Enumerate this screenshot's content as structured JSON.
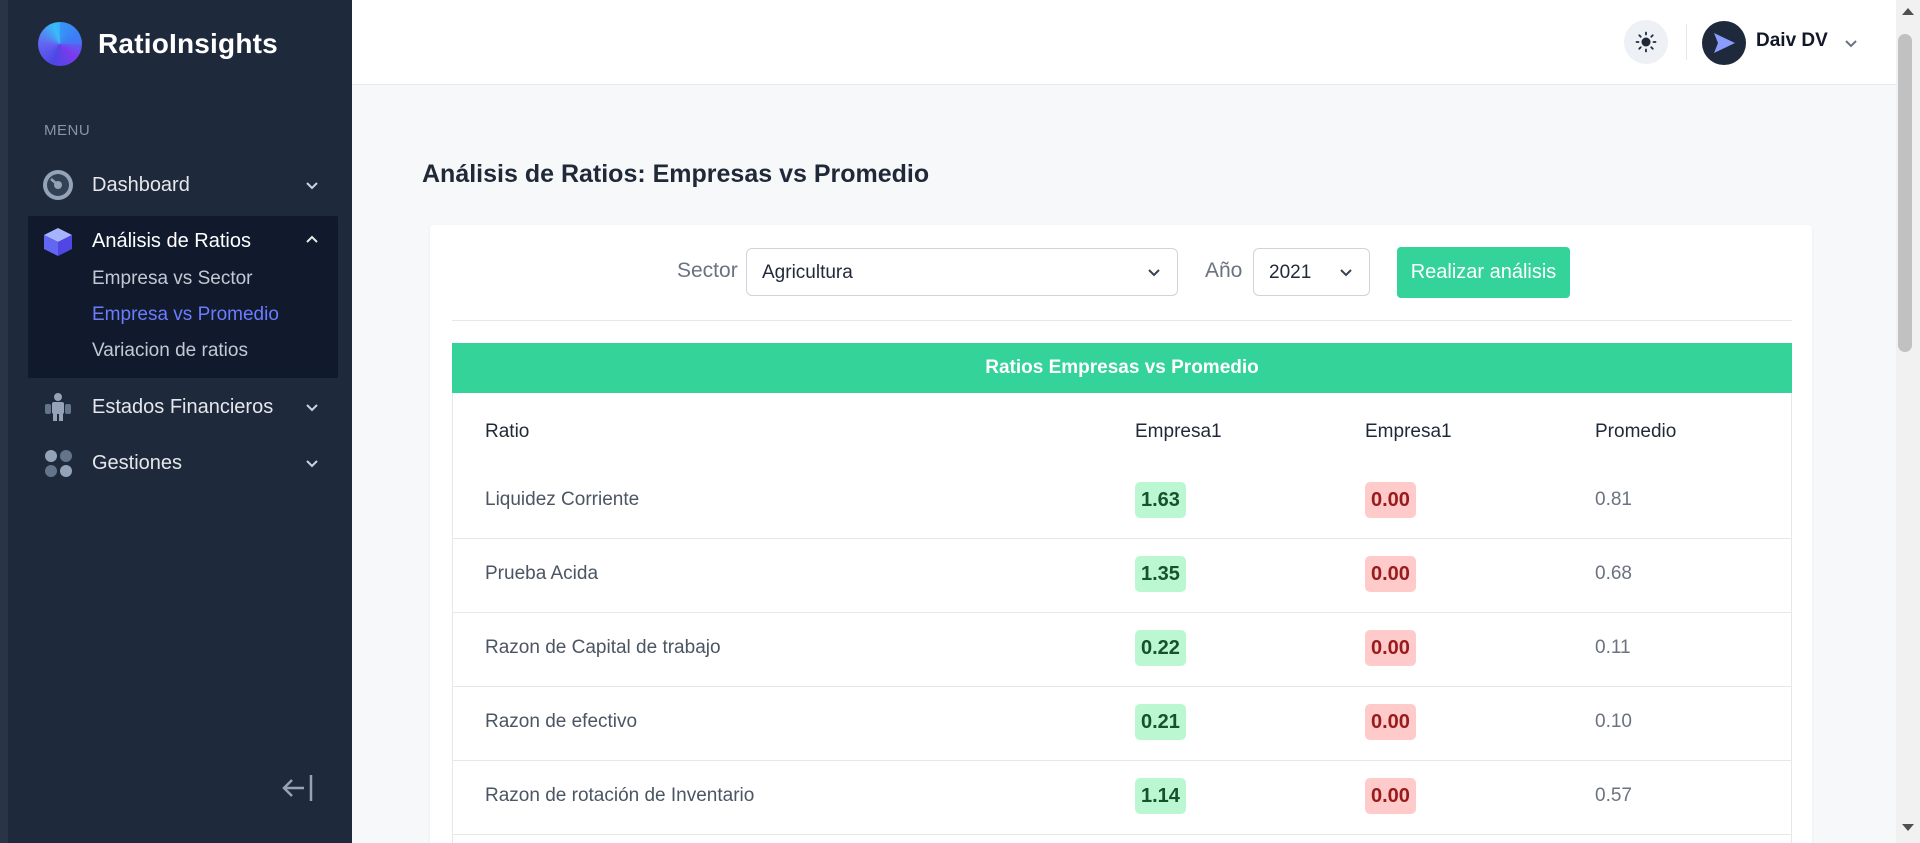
{
  "app": {
    "name": "RatioInsights"
  },
  "sidebar": {
    "menu_label": "MENU",
    "items": [
      {
        "label": "Dashboard",
        "icon": "gauge-icon"
      },
      {
        "label": "Análisis de Ratios",
        "icon": "cube-icon",
        "children": [
          {
            "label": "Empresa vs Sector"
          },
          {
            "label": "Empresa vs Promedio",
            "active": true
          },
          {
            "label": "Variacion de ratios"
          }
        ]
      },
      {
        "label": "Estados Financieros",
        "icon": "people-icon"
      },
      {
        "label": "Gestiones",
        "icon": "dots-grid-icon"
      }
    ]
  },
  "header": {
    "user_name": "Daiv DV"
  },
  "main": {
    "title": "Análisis de Ratios: Empresas vs Promedio",
    "filters": {
      "sector_label": "Sector",
      "sector_value": "Agricultura",
      "year_label": "Año",
      "year_value": "2021",
      "analyze_button": "Realizar análisis"
    },
    "table": {
      "title": "Ratios Empresas vs Promedio",
      "columns": [
        "Ratio",
        "Empresa1",
        "Empresa1",
        "Promedio"
      ],
      "rows": [
        {
          "ratio": "Liquidez Corriente",
          "e1": "1.63",
          "e2": "0.00",
          "avg": "0.81"
        },
        {
          "ratio": "Prueba Acida",
          "e1": "1.35",
          "e2": "0.00",
          "avg": "0.68"
        },
        {
          "ratio": "Razon de Capital de trabajo",
          "e1": "0.22",
          "e2": "0.00",
          "avg": "0.11"
        },
        {
          "ratio": "Razon de efectivo",
          "e1": "0.21",
          "e2": "0.00",
          "avg": "0.10"
        },
        {
          "ratio": "Razon de rotación de Inventario",
          "e1": "1.14",
          "e2": "0.00",
          "avg": "0.57"
        }
      ]
    }
  },
  "colors": {
    "accent": "#34d399",
    "sidebar_bg": "#1e293b",
    "active_link": "#6b7cff",
    "good_bg": "#bbf7d0",
    "bad_bg": "#fecaca"
  }
}
